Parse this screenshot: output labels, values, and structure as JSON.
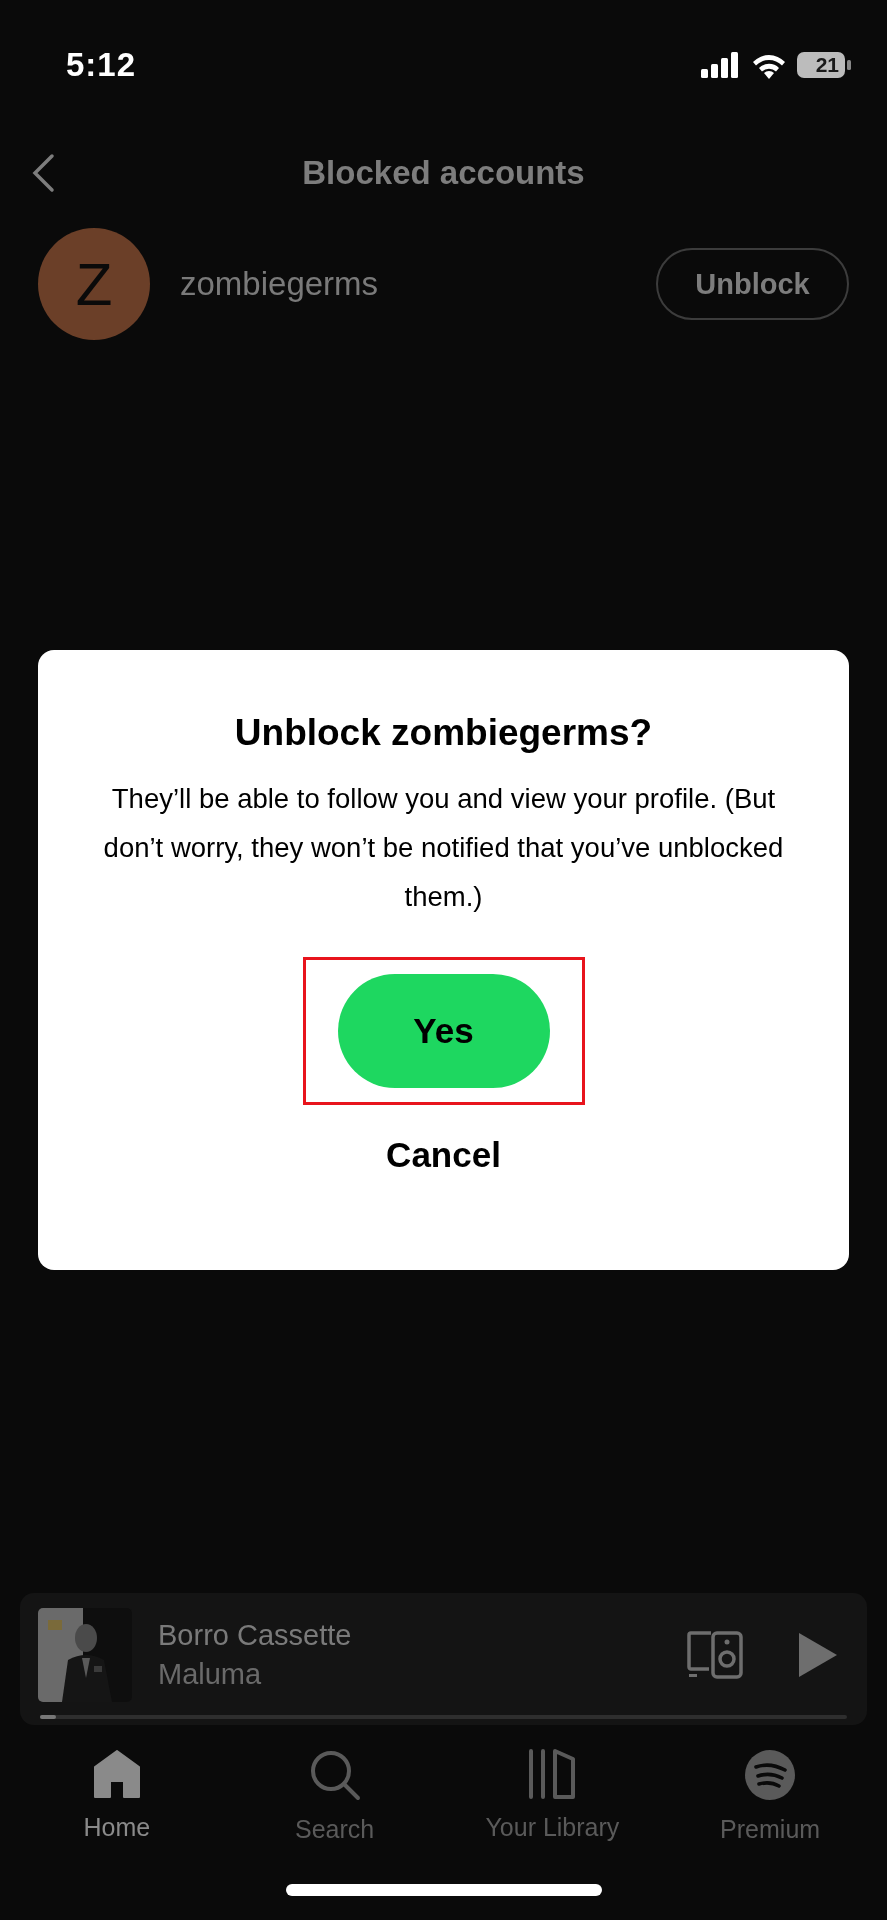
{
  "status_bar": {
    "time": "5:12",
    "battery": "21"
  },
  "header": {
    "title": "Blocked accounts"
  },
  "blocked_accounts": [
    {
      "initial": "Z",
      "name": "zombiegerms",
      "color": "#6b3f28",
      "action": "Unblock"
    }
  ],
  "dialog": {
    "title": "Unblock zombiegerms?",
    "message": "They’ll be able to follow you and view your profile. (But don’t worry, they won’t be notified that you’ve unblocked them.)",
    "buttons": [
      {
        "kind": "primary",
        "label": "Yes",
        "highlighted": true
      },
      {
        "kind": "text",
        "label": "Cancel",
        "highlighted": false
      }
    ]
  },
  "now_playing": {
    "title": "Borro Cassette",
    "artist": "Maluma",
    "level": 0.02
  },
  "tabs": [
    {
      "label": "Home",
      "selected": true
    },
    {
      "label": "Search",
      "selected": false
    },
    {
      "label": "Your Library",
      "selected": false
    },
    {
      "label": "Premium",
      "selected": false
    }
  ]
}
